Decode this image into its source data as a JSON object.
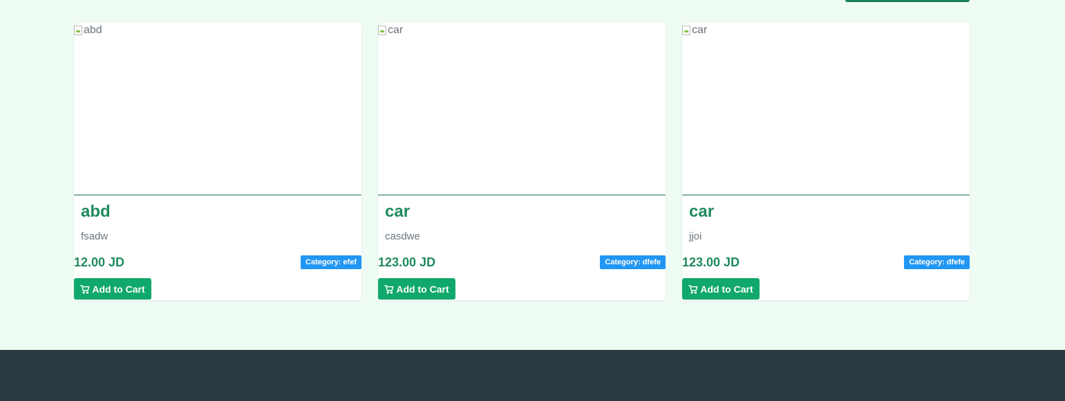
{
  "products": [
    {
      "image_alt": "abd",
      "title": "abd",
      "description": "fsadw",
      "price": "12.00 JD",
      "category": "Category: efef",
      "button_label": "Add to Cart"
    },
    {
      "image_alt": "car",
      "title": "car",
      "description": "casdwe",
      "price": "123.00 JD",
      "category": "Category: dfefe",
      "button_label": "Add to Cart"
    },
    {
      "image_alt": "car",
      "title": "car",
      "description": "jjoi",
      "price": "123.00 JD",
      "category": "Category: dfefe",
      "button_label": "Add to Cart"
    }
  ],
  "colors": {
    "page_background": "#effcf3",
    "primary_green": "#1f8a5b",
    "button_green": "#11a86b",
    "badge_blue": "#2196f3",
    "footer": "#2b3a42"
  },
  "icons": {
    "cart": "cart-icon",
    "broken_image": "broken-image-icon"
  }
}
